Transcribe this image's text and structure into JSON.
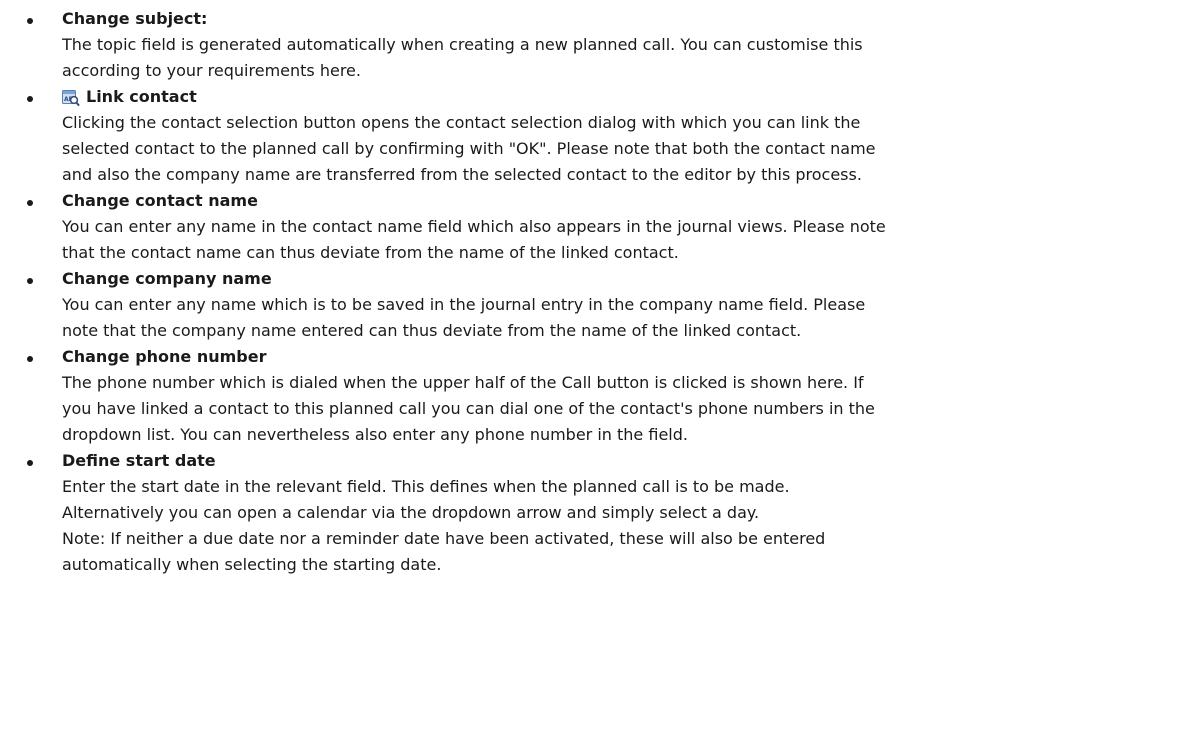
{
  "items": [
    {
      "heading": "Change subject:",
      "lines": [
        "The topic field is generated  automatically when creating a new planned call. You can customise this",
        "according to your requirements  here."
      ]
    },
    {
      "icon": "contact-selection-icon",
      "heading": "Link contact",
      "lines": [
        "Clicking the contact selection button opens the contact selection dialog with which you can link the",
        "selected  contact to the planned  call by confirming with \"OK\". Please note that both the contact name",
        "and also the company name are transferred  from the selected  contact to the editor by this process."
      ]
    },
    {
      "heading": "Change contact name",
      "lines": [
        "You can enter any name in the contact name field which also appears  in the journal views. Please note",
        "that the contact name can thus deviate from the name of the linked contact."
      ]
    },
    {
      "heading": "Change company name",
      "lines": [
        "You can enter any name which is to be saved in the journal entry in the company name field.  Please",
        "note that the company name entered  can thus deviate  from the name of the linked contact."
      ]
    },
    {
      "heading": "Change phone  number",
      "lines": [
        "The phone number which is dialed when the upper half of the Call button is clicked is shown here.  If",
        "you have linked a contact to this planned call you can dial one of the contact's phone numbers in the",
        "dropdown list. You can nevertheless  also enter any phone number in the field."
      ]
    },
    {
      "heading": "Define start date",
      "lines": [
        "Enter the start date in the relevant field.  This defines when the planned  call is to be made.",
        "Alternatively  you can open a calendar via the dropdown arrow and simply select a day.",
        "Note: If neither a due date nor a reminder date have been activated, these will also be entered",
        "automatically when selecting the starting date."
      ]
    }
  ]
}
